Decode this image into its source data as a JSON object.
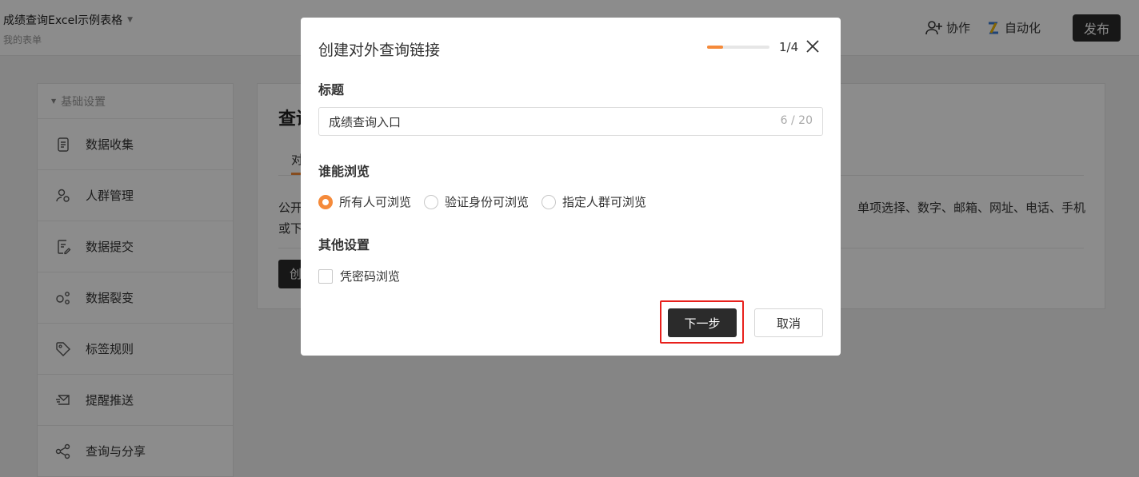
{
  "header": {
    "title": "成绩查询Excel示例表格",
    "subtitle": "我的表单",
    "collab_label": "协作",
    "automation_label": "自动化",
    "publish_label": "发布"
  },
  "sidebar": {
    "section_label": "基础设置",
    "items": [
      {
        "label": "数据收集",
        "icon": "document-icon"
      },
      {
        "label": "人群管理",
        "icon": "people-icon"
      },
      {
        "label": "数据提交",
        "icon": "edit-doc-icon"
      },
      {
        "label": "数据裂变",
        "icon": "fission-icon"
      },
      {
        "label": "标签规则",
        "icon": "tag-icon"
      },
      {
        "label": "提醒推送",
        "icon": "mail-icon"
      },
      {
        "label": "查询与分享",
        "icon": "share-icon"
      }
    ]
  },
  "main": {
    "title": "查询",
    "tab": "对",
    "text_line1_left": "公开",
    "text_line1_right": "单项选择、数字、邮箱、网址、电话、手机",
    "text_line2_left": "或下",
    "button_label": "创"
  },
  "modal": {
    "title": "创建对外查询链接",
    "progress": 0.25,
    "step": "1/4",
    "title_section_label": "标题",
    "title_input_value": "成绩查询入口",
    "title_char_count": "6 / 20",
    "visibility_label": "谁能浏览",
    "visibility_options": [
      {
        "label": "所有人可浏览",
        "selected": true
      },
      {
        "label": "验证身份可浏览",
        "selected": false
      },
      {
        "label": "指定人群可浏览",
        "selected": false
      }
    ],
    "other_settings_label": "其他设置",
    "password_checkbox_label": "凭密码浏览",
    "password_checked": false,
    "next_label": "下一步",
    "cancel_label": "取消"
  },
  "colors": {
    "accent": "#f58a3a",
    "dark_button": "#2b2b2b",
    "highlight": "#e8201c"
  }
}
